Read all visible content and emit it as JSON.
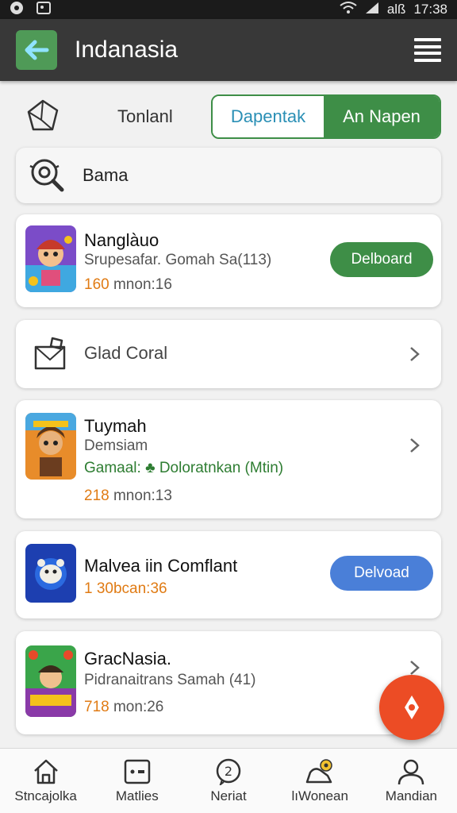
{
  "status": {
    "signal": "all",
    "mobile": "alß",
    "time": "17:38"
  },
  "appbar": {
    "title": "Indanasia",
    "back_icon": "arrow-left-icon",
    "menu_icon": "hamburger-icon"
  },
  "toprow": {
    "label": "Tonlanl",
    "tab_left": "Dapentak",
    "tab_right": "An Napen"
  },
  "search": {
    "label": "Bama"
  },
  "items": [
    {
      "title": "Nanglàuo",
      "subtitle": "Srupesafar. Gomah Sa(113)",
      "meta_num": "160",
      "meta_rest": " mnon:16",
      "button": "Delboard",
      "button_color": "#3e8e47"
    },
    {
      "title": "Glad Coral"
    },
    {
      "title": "Tuymah",
      "subtitle": "Demsiam",
      "green_text": "Gamaal: ♣ Doloratnkan (Mtin)",
      "meta_num": "218",
      "meta_rest": " mnon:13"
    },
    {
      "title": "Malvea iin Comflant",
      "meta_num": "1 30",
      "meta_rest": "bcan:36",
      "button": "Delvoad",
      "button_color": "#4a7fd8"
    },
    {
      "title": "GracNasia.",
      "subtitle": "Pidranaitrans Samah (41)",
      "meta_num": "718",
      "meta_rest": " mon:26"
    }
  ],
  "nav": [
    {
      "label": "Stncajolka",
      "icon": "home-icon"
    },
    {
      "label": "Matlies",
      "icon": "dice-icon"
    },
    {
      "label": "Neriat",
      "icon": "chat-icon"
    },
    {
      "label": "lıWonean",
      "icon": "badge-icon"
    },
    {
      "label": "Mandian",
      "icon": "profile-icon"
    }
  ],
  "colors": {
    "appbar": "#383838",
    "accent_green": "#3e8e47",
    "accent_blue": "#4a7fd8",
    "fab": "#ec4c25"
  }
}
